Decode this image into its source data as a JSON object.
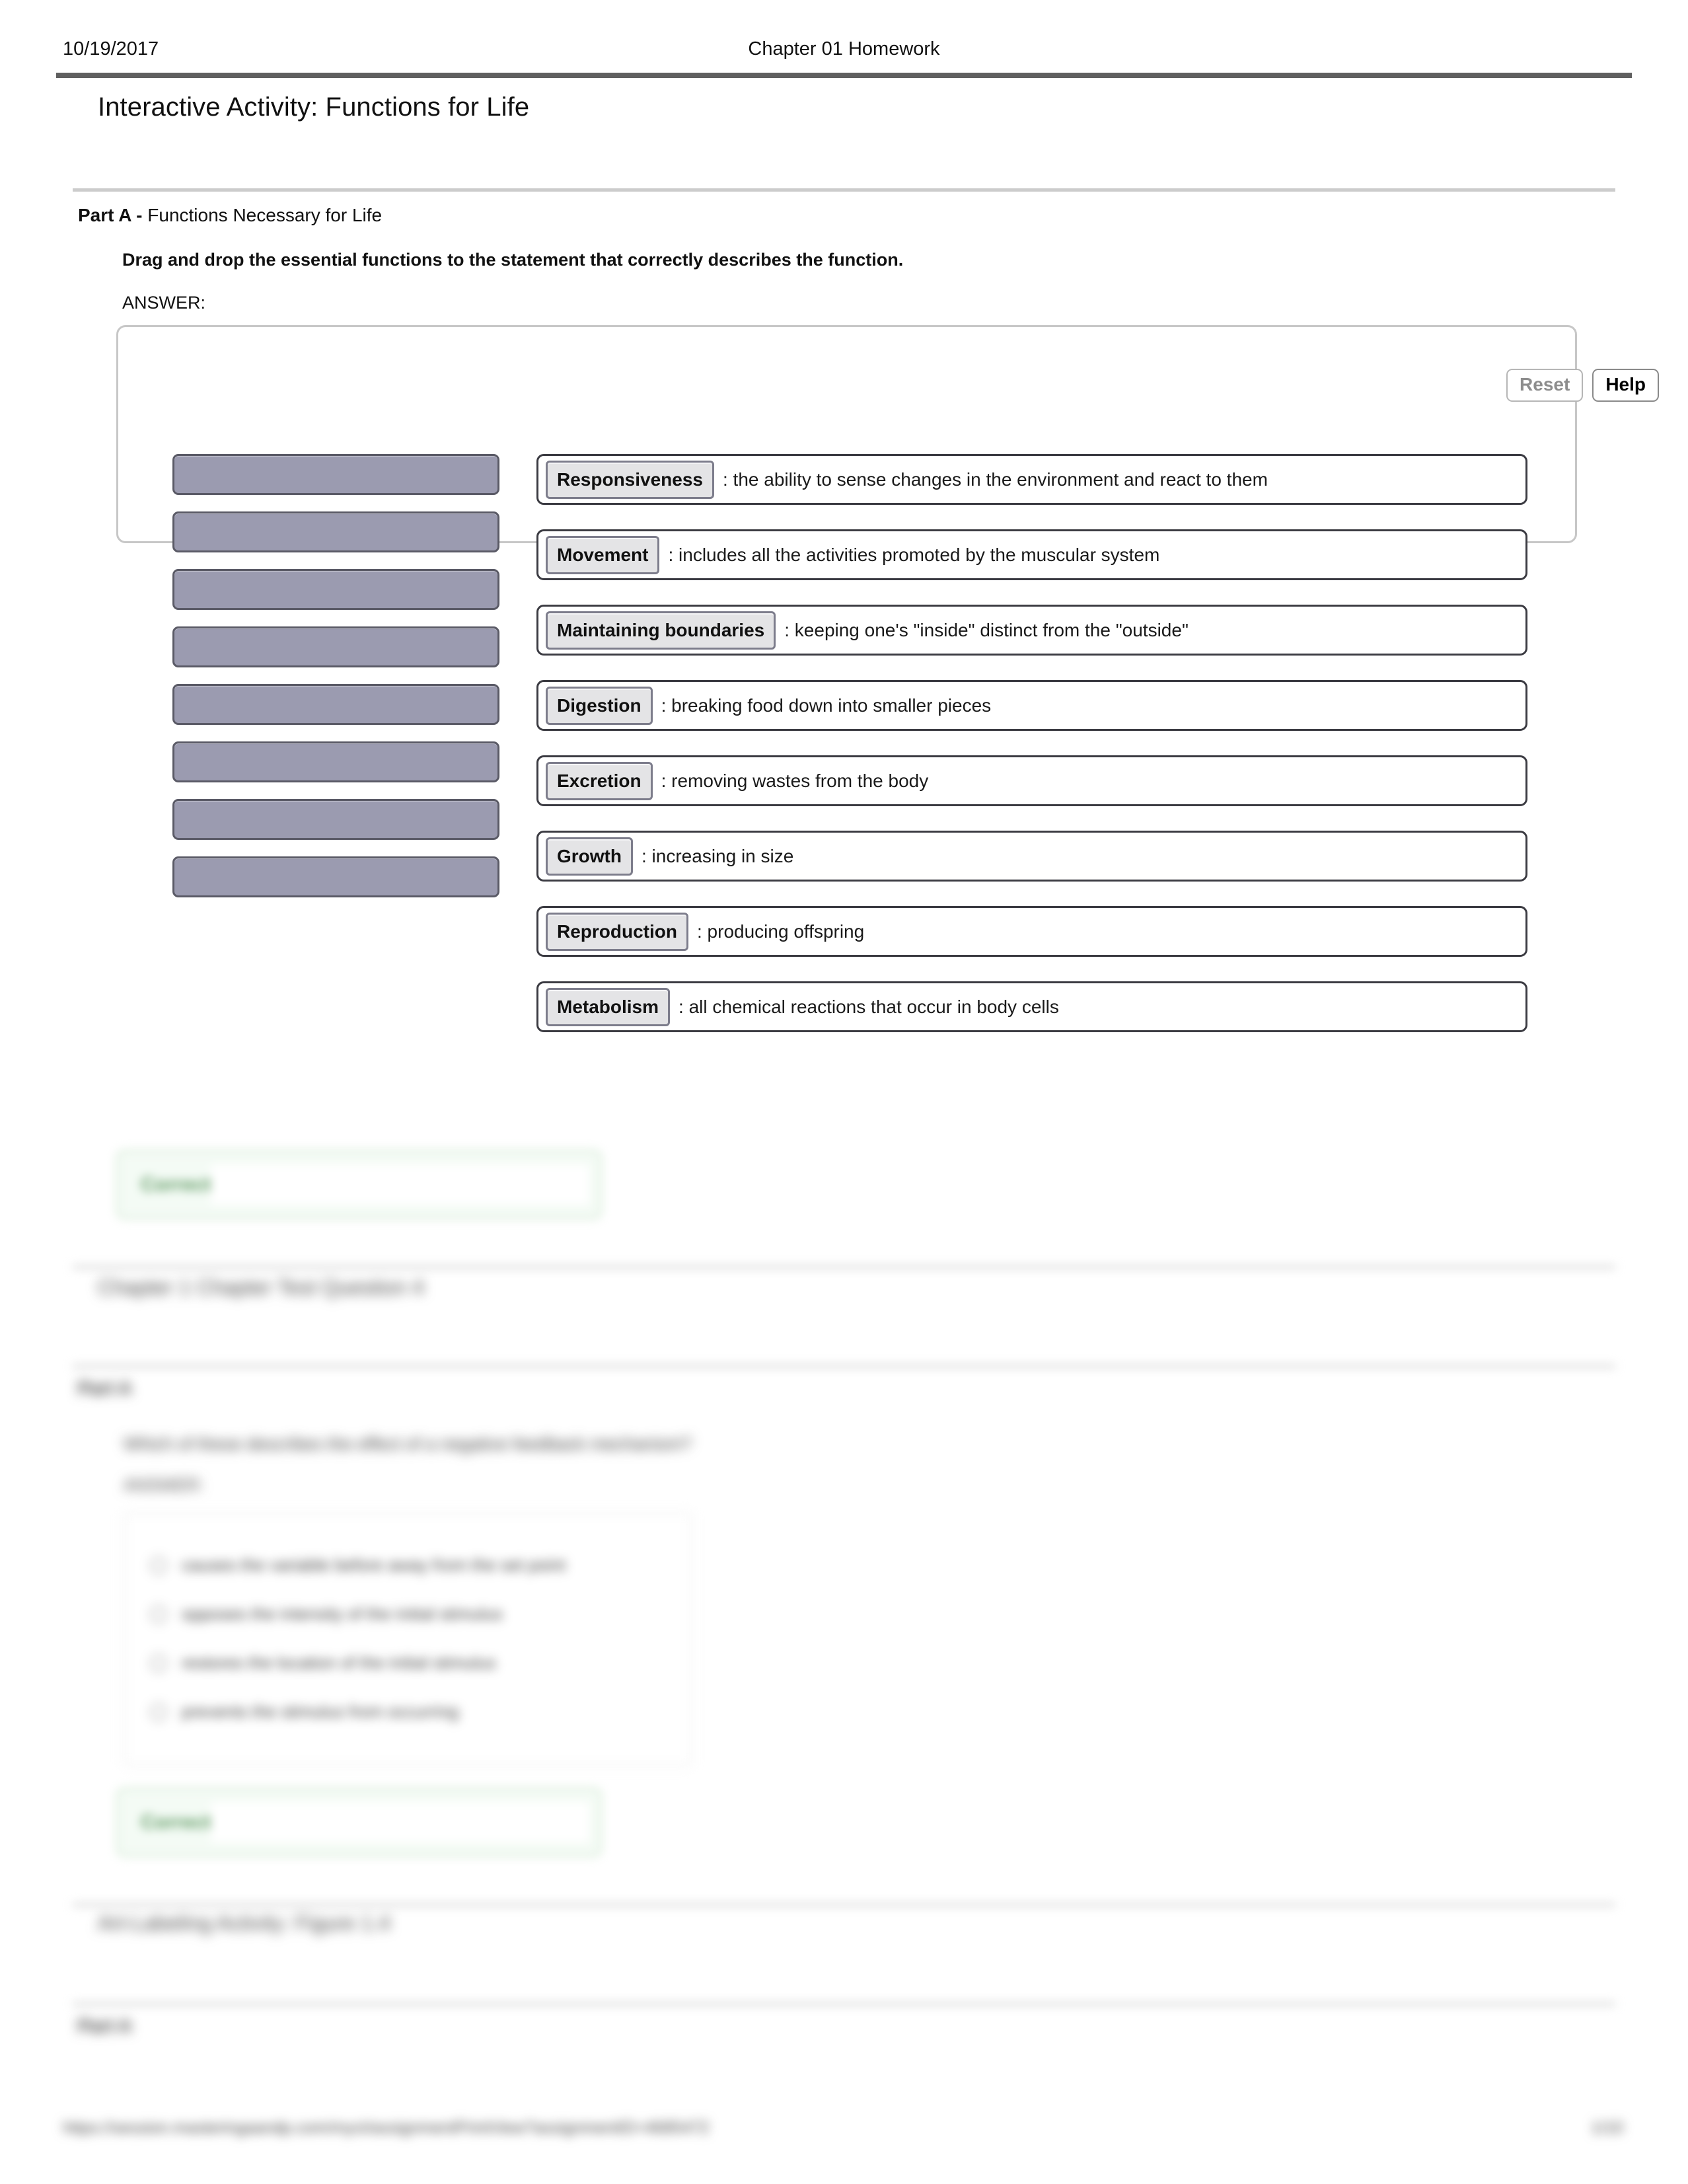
{
  "header": {
    "date": "10/19/2017",
    "document_title": "Chapter 01 Homework"
  },
  "activity": {
    "title": "Interactive Activity: Functions for Life"
  },
  "part_a": {
    "part_label_bold": "Part A -",
    "part_label_rest": " Functions Necessary for Life",
    "instruction": "Drag and drop the essential functions to the statement that correctly describes the function.",
    "answer_label": "ANSWER:",
    "toolbar": {
      "reset_label": "Reset",
      "help_label": "Help",
      "reset_state": "disabled",
      "help_state": "enabled"
    },
    "drag_slots": [
      {
        "label": ""
      },
      {
        "label": ""
      },
      {
        "label": ""
      },
      {
        "label": ""
      },
      {
        "label": ""
      },
      {
        "label": ""
      },
      {
        "label": ""
      },
      {
        "label": ""
      }
    ],
    "statements": [
      {
        "chip": "Responsiveness",
        "text": ": the ability to sense changes in the environment and react to them"
      },
      {
        "chip": "Movement",
        "text": ": includes all the activities promoted by the muscular system"
      },
      {
        "chip": "Maintaining boundaries",
        "text": ": keeping one's \"inside\" distinct from the \"outside\""
      },
      {
        "chip": "Digestion",
        "text": ": breaking food down into smaller pieces"
      },
      {
        "chip": "Excretion",
        "text": ": removing wastes from the body"
      },
      {
        "chip": "Growth",
        "text": ": increasing in size"
      },
      {
        "chip": "Reproduction",
        "text": ": producing offspring"
      },
      {
        "chip": "Metabolism",
        "text": ": all chemical reactions that occur in body cells"
      }
    ],
    "feedback": {
      "tag": "Correct"
    }
  },
  "section_two": {
    "heading": "Chapter 1 Chapter Test Question 4",
    "part_label": "Part A",
    "question": "Which of these describes the effect of a negative feedback mechanism?",
    "answer_label": "ANSWER:",
    "options": [
      {
        "text": "causes the variable before away from the set point"
      },
      {
        "text": "opposes the intensity of the initial stimulus"
      },
      {
        "text": "restores the location of the initial stimulus"
      },
      {
        "text": "prevents the stimulus from occurring"
      }
    ],
    "feedback": {
      "tag": "Correct"
    }
  },
  "section_three": {
    "heading": "Art-Labeling Activity: Figure 1.4",
    "part_label": "Part A"
  },
  "footer": {
    "url": "https://session.masteringaandp.com/myct/assignmentPrintView?assignmentID=4685472",
    "page": "1/10"
  },
  "colors": {
    "header_rule": "#5f5f5f",
    "divider": "#cccccc",
    "drag_slot_fill": "#9b9bb0",
    "drag_slot_border": "#5a5a66",
    "chip_fill": "#e4e4e6",
    "chip_border": "#7d7d8c",
    "statement_border": "#3b3b42",
    "feedback_green": "#5f9a63",
    "feedback_bg": "#f4fbf5"
  }
}
